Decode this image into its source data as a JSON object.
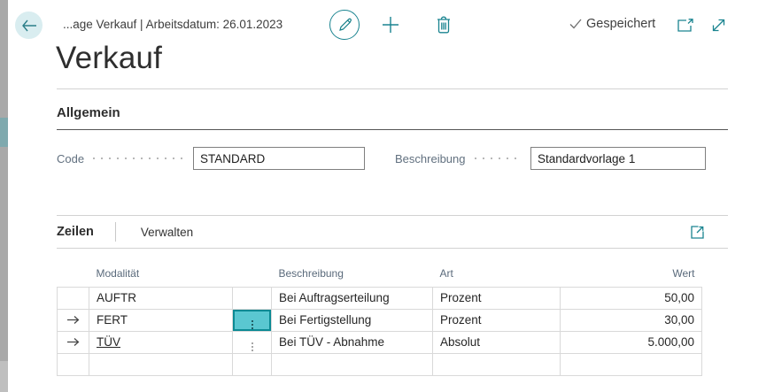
{
  "theme": {
    "accent": "#17808a",
    "selected_cell_bg": "#5ac7d1",
    "selected_cell_border": "#0b8a94"
  },
  "topbar": {
    "breadcrumb": "...age Verkauf | Arbeitsdatum: 26.01.2023",
    "saved_label": "Gespeichert"
  },
  "page": {
    "title": "Verkauf"
  },
  "general": {
    "section_label": "Allgemein",
    "fields": [
      {
        "label": "Code",
        "value": "STANDARD"
      },
      {
        "label": "Beschreibung",
        "value": "Standardvorlage 1"
      }
    ]
  },
  "lines": {
    "section_label": "Zeilen",
    "manage_label": "Verwalten",
    "table": {
      "columns": [
        "Modalität",
        "Beschreibung",
        "Art",
        "Wert"
      ],
      "rows": [
        {
          "modalitaet": "AUFTR",
          "beschreibung": "Bei Auftragserteilung",
          "art": "Prozent",
          "wert": "50,00"
        },
        {
          "modalitaet": "FERT",
          "beschreibung": "Bei Fertigstellung",
          "art": "Prozent",
          "wert": "30,00"
        },
        {
          "modalitaet": "TÜV",
          "beschreibung": "Bei TÜV - Abnahme",
          "art": "Absolut",
          "wert": "5.000,00"
        },
        {
          "modalitaet": "",
          "beschreibung": "",
          "art": "",
          "wert": ""
        }
      ]
    }
  }
}
